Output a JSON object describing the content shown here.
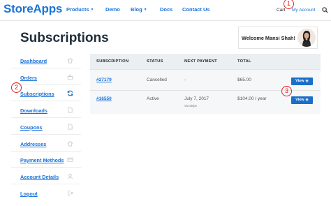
{
  "header": {
    "logo": "StoreApps",
    "nav": [
      {
        "label": "Products",
        "caret": "▼"
      },
      {
        "label": "Demo",
        "caret": ""
      },
      {
        "label": "Blog",
        "caret": "▼"
      },
      {
        "label": "Docs",
        "caret": ""
      },
      {
        "label": "Contact Us",
        "caret": ""
      }
    ],
    "cart": "Cart",
    "account": "My Account",
    "search_icon": "search-icon"
  },
  "annotations": [
    "1",
    "2",
    "3"
  ],
  "page_title": "Subscriptions",
  "welcome": "Welcome Mansi Shah!",
  "sidebar": {
    "items": [
      {
        "label": "Dashboard",
        "icon": "house-icon"
      },
      {
        "label": "Orders",
        "icon": "basket-icon"
      },
      {
        "label": "Subscriptions",
        "icon": "refresh-icon"
      },
      {
        "label": "Downloads",
        "icon": "file-icon"
      },
      {
        "label": "Coupons",
        "icon": "file-icon"
      },
      {
        "label": "Addresses",
        "icon": "house-icon"
      },
      {
        "label": "Payment Methods",
        "icon": "card-icon"
      },
      {
        "label": "Account Details",
        "icon": "user-icon"
      },
      {
        "label": "Logout",
        "icon": "logout-icon"
      }
    ]
  },
  "table": {
    "headers": [
      "SUBSCRIPTION",
      "STATUS",
      "NEXT PAYMENT",
      "TOTAL"
    ],
    "rows": [
      {
        "id": "#27179",
        "status": "Cancelled",
        "next_payment": "-",
        "via": "",
        "total": "$65.00",
        "action": "View"
      },
      {
        "id": "#16550",
        "status": "Active",
        "next_payment": "July 7, 2017",
        "via": "Via Stripe",
        "total": "$104.00 / year",
        "action": "View"
      }
    ]
  },
  "colors": {
    "accent": "#1a73d9",
    "button": "#1b6fc9",
    "annotation": "#e02020"
  }
}
